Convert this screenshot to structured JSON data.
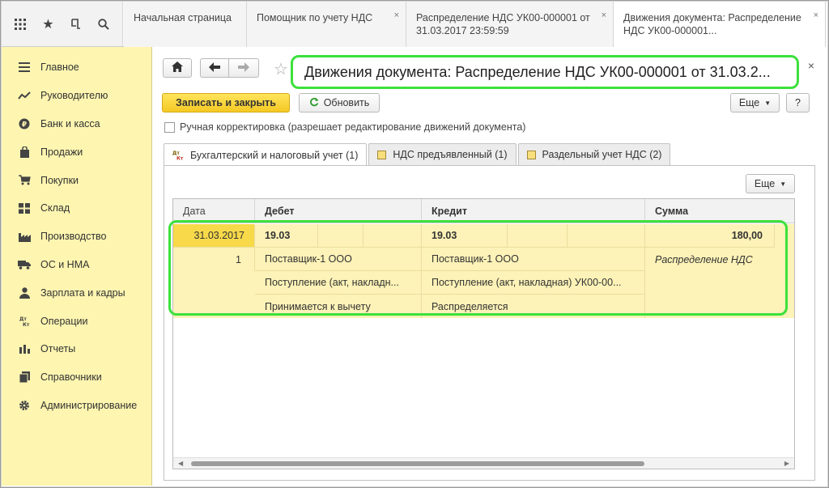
{
  "top_tabs": [
    {
      "label": "Начальная страница"
    },
    {
      "label": "Помощник по учету НДС",
      "close": "×"
    },
    {
      "label": "Распределение НДС УК00-000001 от 31.03.2017 23:59:59",
      "close": "×"
    },
    {
      "label": "Движения документа: Распределение НДС УК00-000001...",
      "close": "×"
    }
  ],
  "quick_icons": [
    "apps-grid-icon",
    "star-icon",
    "history-icon",
    "search-icon"
  ],
  "sidebar": {
    "items": [
      {
        "label": "Главное",
        "icon": "menu-icon"
      },
      {
        "label": "Руководителю",
        "icon": "trend-icon"
      },
      {
        "label": "Банк и касса",
        "icon": "ruble-icon"
      },
      {
        "label": "Продажи",
        "icon": "bag-icon"
      },
      {
        "label": "Покупки",
        "icon": "cart-icon"
      },
      {
        "label": "Склад",
        "icon": "warehouse-icon"
      },
      {
        "label": "Производство",
        "icon": "factory-icon"
      },
      {
        "label": "ОС и НМА",
        "icon": "truck-icon"
      },
      {
        "label": "Зарплата и кадры",
        "icon": "person-icon"
      },
      {
        "label": "Операции",
        "icon": "dt-kt-icon"
      },
      {
        "label": "Отчеты",
        "icon": "bar-chart-icon"
      },
      {
        "label": "Справочники",
        "icon": "books-icon"
      },
      {
        "label": "Администрирование",
        "icon": "gear-icon"
      }
    ]
  },
  "form": {
    "title": "Движения документа: Распределение НДС УК00-000001 от 31.03.2...",
    "close": "×",
    "save_close": "Записать и закрыть",
    "refresh": "Обновить",
    "more": "Еще",
    "help": "?",
    "manual_correction": "Ручная корректировка (разрешает редактирование движений документа)",
    "tabs": [
      {
        "label": "Бухгалтерский и налоговый учет (1)"
      },
      {
        "label": "НДС предъявленный (1)"
      },
      {
        "label": "Раздельный учет НДС (2)"
      }
    ],
    "table_more": "Еще"
  },
  "table": {
    "columns": [
      "Дата",
      "Дебет",
      "Кредит",
      "Сумма"
    ],
    "row": {
      "date": "31.03.2017",
      "number": "1",
      "debit_account": "19.03",
      "credit_account": "19.03",
      "amount": "180,00",
      "debit_sub1": "Поставщик-1 ООО",
      "credit_sub1": "Поставщик-1 ООО",
      "content": "Распределение НДС",
      "debit_sub2": "Поступление (акт, накладн...",
      "credit_sub2": "Поступление (акт, накладная) УК00-00...",
      "debit_sub3": "Принимается к вычету",
      "credit_sub3": "Распределяется"
    }
  }
}
